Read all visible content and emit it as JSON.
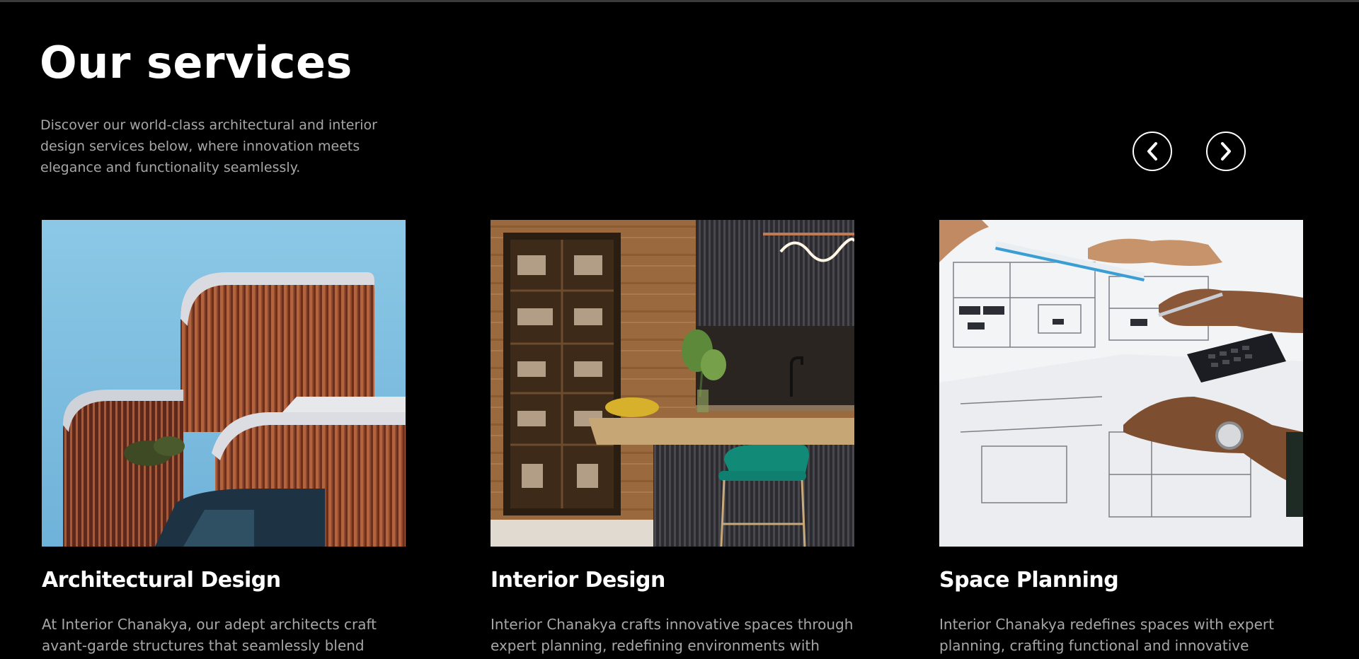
{
  "header": {
    "title": "Our services",
    "intro": "Discover our world-class architectural and interior design services below, where innovation meets elegance and functionality seamlessly."
  },
  "carousel": {
    "prev_icon": "chevron-left-icon",
    "next_icon": "chevron-right-icon"
  },
  "services": [
    {
      "title": "Architectural Design",
      "description": "At Interior Chanakya, our adept architects craft avant-garde structures that seamlessly blend",
      "image": "building-facade-photo"
    },
    {
      "title": "Interior Design",
      "description": "Interior Chanakya crafts innovative spaces through expert planning, redefining environments with",
      "image": "kitchen-interior-photo"
    },
    {
      "title": "Space Planning",
      "description": "Interior Chanakya redefines spaces with expert planning, crafting functional and innovative",
      "image": "blueprint-planning-photo"
    }
  ],
  "colors": {
    "background": "#000000",
    "heading": "#ffffff",
    "body_text": "#a7a7a7"
  }
}
